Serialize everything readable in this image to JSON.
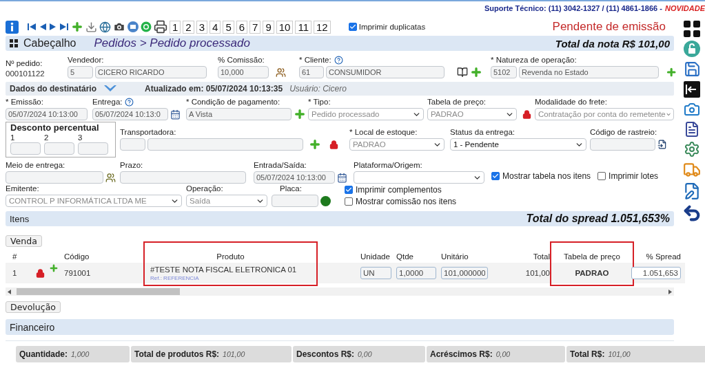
{
  "support": {
    "label": "Suporte Técnico: (11) 3042-1327 / (11) 4861-1866 -",
    "news": "NOVIDADE"
  },
  "toolbar": {
    "pages": [
      "1",
      "2",
      "3",
      "4",
      "5",
      "6",
      "7",
      "9",
      "10",
      "11",
      "12"
    ],
    "print_duplicates": {
      "label": "Imprimir duplicatas",
      "checked": true
    },
    "status": "Pendente de emissão"
  },
  "header": {
    "title": "Cabeçalho",
    "breadcrumb": "Pedidos > Pedido processado",
    "total": "Total da nota R$ 101,00"
  },
  "order": {
    "label": "Nº pedido:",
    "number": "000101122"
  },
  "seller": {
    "label": "Vendedor:",
    "code": "5",
    "name": "CICERO RICARDO"
  },
  "commission": {
    "label": "% Comissão:",
    "value": "10,000"
  },
  "client": {
    "label": "* Cliente:",
    "code": "61",
    "name": "CONSUMIDOR"
  },
  "operation_nature": {
    "label": "* Natureza de operação:",
    "code": "5102",
    "name": "Revenda no Estado"
  },
  "recipient_bar": {
    "label": "Dados do destinatário",
    "updated": "Atualizado em: 05/07/2024 10:13:35",
    "user": "Usuário: Cicero"
  },
  "emission": {
    "label": "* Emissão:",
    "value": "05/07/2024 10:13:00"
  },
  "delivery": {
    "label": "Entrega:",
    "value": "05/07/2024 10:13:0"
  },
  "payment": {
    "label": "* Condição de pagamento:",
    "value": "A Vista"
  },
  "type": {
    "label": "* Tipo:",
    "value": "Pedido processado",
    "disabled": true
  },
  "price_table": {
    "label": "Tabela de preço:",
    "value": "PADRAO",
    "disabled": true
  },
  "freight": {
    "label": "Modalidade do frete:",
    "value": "Contratação por conta do remetente",
    "disabled": true
  },
  "discount": {
    "title": "Desconto percentual",
    "fields": [
      "1",
      "2",
      "3"
    ]
  },
  "carrier": {
    "label": "Transportadora:"
  },
  "stock": {
    "label": "* Local de estoque:",
    "value": "PADRAO",
    "disabled": true
  },
  "delivery_status": {
    "label": "Status da entrega:",
    "value": "1 - Pendente",
    "disabled": false
  },
  "tracking": {
    "label": "Código de rastreio:"
  },
  "delivery_method": {
    "label": "Meio de entrega:"
  },
  "term": {
    "label": "Prazo:"
  },
  "in_out": {
    "label": "Entrada/Saída:",
    "value": "05/07/2024 10:13:00"
  },
  "platform": {
    "label": "Plataforma/Origem:"
  },
  "options": [
    {
      "label": "Mostrar tabela nos itens",
      "checked": true
    },
    {
      "label": "Imprimir lotes",
      "checked": false
    },
    {
      "label": "Imprimir complementos",
      "checked": true
    },
    {
      "label": "Mostrar comissão nos itens",
      "checked": false
    }
  ],
  "issuer": {
    "label": "Emitente:",
    "value": "CONTROL P INFORMÁTICA LTDA ME",
    "disabled": true
  },
  "operation": {
    "label": "Operação:",
    "value": "Saída",
    "disabled": true
  },
  "plate": {
    "label": "Placa:"
  },
  "items": {
    "title": "Itens",
    "spread_total": "Total do spread 1.051,653%",
    "sale_button": "Venda",
    "columns": [
      {
        "label": "#",
        "kind": "text",
        "highlighted": false
      },
      {
        "label": "Código",
        "kind": "text",
        "highlighted": false
      },
      {
        "label": "Produto",
        "kind": "product",
        "highlighted": true
      },
      {
        "label": "Unidade",
        "kind": "input",
        "highlighted": false
      },
      {
        "label": "Qtde",
        "kind": "input",
        "highlighted": false
      },
      {
        "label": "Unitário",
        "kind": "input",
        "highlighted": false
      },
      {
        "label": "Total",
        "kind": "text",
        "highlighted": false
      },
      {
        "label": "Tabela de preço",
        "kind": "strong",
        "highlighted": true
      },
      {
        "label": "% Spread",
        "kind": "input",
        "highlighted": false
      }
    ],
    "rows": [
      {
        "cells": [
          "1",
          "791001",
          "#TESTE NOTA FISCAL ELETRONICA 01",
          "UN",
          "1,0000",
          "101,000000",
          "101,00",
          "PADRAO",
          "1.051,653"
        ],
        "reference": "Ref.: REFERENCIA"
      }
    ],
    "return_button": "Devolução"
  },
  "finance": {
    "title": "Financeiro"
  },
  "totals": [
    {
      "label": "Quantidade:",
      "value": "1,000"
    },
    {
      "label": "Total de produtos R$:",
      "value": "101,00"
    },
    {
      "label": "Descontos R$:",
      "value": "0,00"
    },
    {
      "label": "Acréscimos R$:",
      "value": "0,00"
    },
    {
      "label": "Total R$:",
      "value": "101,00"
    }
  ]
}
